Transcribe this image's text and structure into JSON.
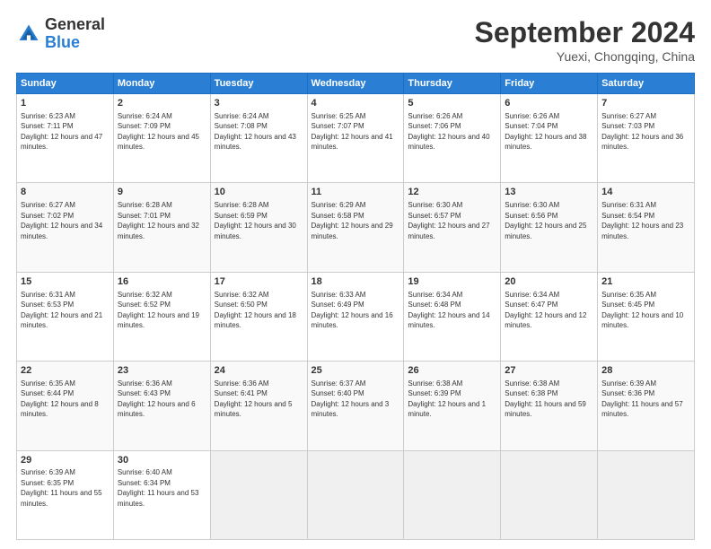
{
  "logo": {
    "general": "General",
    "blue": "Blue"
  },
  "header": {
    "title": "September 2024",
    "location": "Yuexi, Chongqing, China"
  },
  "weekdays": [
    "Sunday",
    "Monday",
    "Tuesday",
    "Wednesday",
    "Thursday",
    "Friday",
    "Saturday"
  ],
  "weeks": [
    [
      {
        "day": "1",
        "rise": "6:23 AM",
        "set": "7:11 PM",
        "daylight": "12 hours and 47 minutes."
      },
      {
        "day": "2",
        "rise": "6:24 AM",
        "set": "7:09 PM",
        "daylight": "12 hours and 45 minutes."
      },
      {
        "day": "3",
        "rise": "6:24 AM",
        "set": "7:08 PM",
        "daylight": "12 hours and 43 minutes."
      },
      {
        "day": "4",
        "rise": "6:25 AM",
        "set": "7:07 PM",
        "daylight": "12 hours and 41 minutes."
      },
      {
        "day": "5",
        "rise": "6:26 AM",
        "set": "7:06 PM",
        "daylight": "12 hours and 40 minutes."
      },
      {
        "day": "6",
        "rise": "6:26 AM",
        "set": "7:04 PM",
        "daylight": "12 hours and 38 minutes."
      },
      {
        "day": "7",
        "rise": "6:27 AM",
        "set": "7:03 PM",
        "daylight": "12 hours and 36 minutes."
      }
    ],
    [
      {
        "day": "8",
        "rise": "6:27 AM",
        "set": "7:02 PM",
        "daylight": "12 hours and 34 minutes."
      },
      {
        "day": "9",
        "rise": "6:28 AM",
        "set": "7:01 PM",
        "daylight": "12 hours and 32 minutes."
      },
      {
        "day": "10",
        "rise": "6:28 AM",
        "set": "6:59 PM",
        "daylight": "12 hours and 30 minutes."
      },
      {
        "day": "11",
        "rise": "6:29 AM",
        "set": "6:58 PM",
        "daylight": "12 hours and 29 minutes."
      },
      {
        "day": "12",
        "rise": "6:30 AM",
        "set": "6:57 PM",
        "daylight": "12 hours and 27 minutes."
      },
      {
        "day": "13",
        "rise": "6:30 AM",
        "set": "6:56 PM",
        "daylight": "12 hours and 25 minutes."
      },
      {
        "day": "14",
        "rise": "6:31 AM",
        "set": "6:54 PM",
        "daylight": "12 hours and 23 minutes."
      }
    ],
    [
      {
        "day": "15",
        "rise": "6:31 AM",
        "set": "6:53 PM",
        "daylight": "12 hours and 21 minutes."
      },
      {
        "day": "16",
        "rise": "6:32 AM",
        "set": "6:52 PM",
        "daylight": "12 hours and 19 minutes."
      },
      {
        "day": "17",
        "rise": "6:32 AM",
        "set": "6:50 PM",
        "daylight": "12 hours and 18 minutes."
      },
      {
        "day": "18",
        "rise": "6:33 AM",
        "set": "6:49 PM",
        "daylight": "12 hours and 16 minutes."
      },
      {
        "day": "19",
        "rise": "6:34 AM",
        "set": "6:48 PM",
        "daylight": "12 hours and 14 minutes."
      },
      {
        "day": "20",
        "rise": "6:34 AM",
        "set": "6:47 PM",
        "daylight": "12 hours and 12 minutes."
      },
      {
        "day": "21",
        "rise": "6:35 AM",
        "set": "6:45 PM",
        "daylight": "12 hours and 10 minutes."
      }
    ],
    [
      {
        "day": "22",
        "rise": "6:35 AM",
        "set": "6:44 PM",
        "daylight": "12 hours and 8 minutes."
      },
      {
        "day": "23",
        "rise": "6:36 AM",
        "set": "6:43 PM",
        "daylight": "12 hours and 6 minutes."
      },
      {
        "day": "24",
        "rise": "6:36 AM",
        "set": "6:41 PM",
        "daylight": "12 hours and 5 minutes."
      },
      {
        "day": "25",
        "rise": "6:37 AM",
        "set": "6:40 PM",
        "daylight": "12 hours and 3 minutes."
      },
      {
        "day": "26",
        "rise": "6:38 AM",
        "set": "6:39 PM",
        "daylight": "12 hours and 1 minute."
      },
      {
        "day": "27",
        "rise": "6:38 AM",
        "set": "6:38 PM",
        "daylight": "11 hours and 59 minutes."
      },
      {
        "day": "28",
        "rise": "6:39 AM",
        "set": "6:36 PM",
        "daylight": "11 hours and 57 minutes."
      }
    ],
    [
      {
        "day": "29",
        "rise": "6:39 AM",
        "set": "6:35 PM",
        "daylight": "11 hours and 55 minutes."
      },
      {
        "day": "30",
        "rise": "6:40 AM",
        "set": "6:34 PM",
        "daylight": "11 hours and 53 minutes."
      },
      null,
      null,
      null,
      null,
      null
    ]
  ]
}
